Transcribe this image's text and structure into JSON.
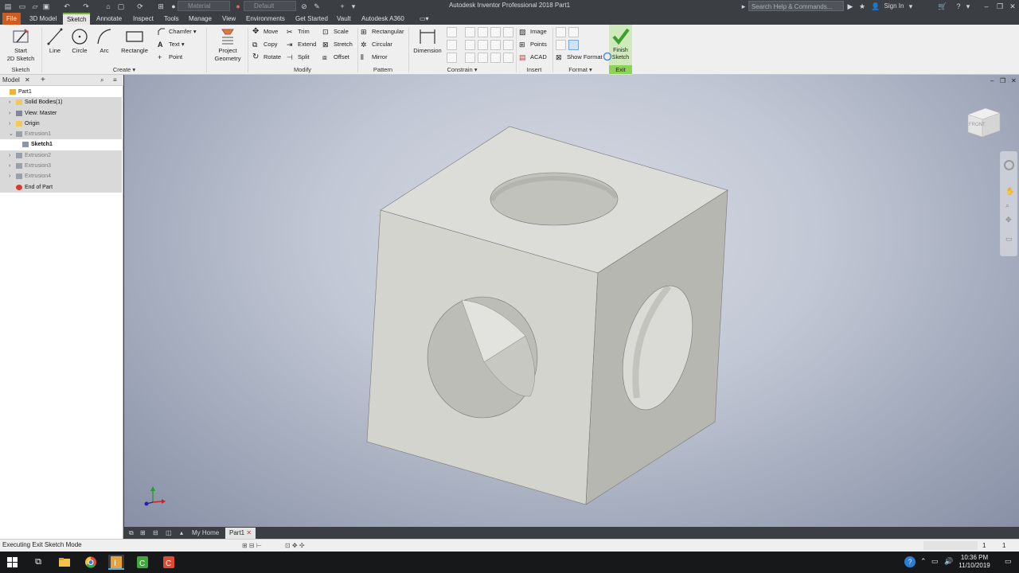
{
  "titlebar": {
    "title": "Autodesk Inventor Professional 2018   Part1",
    "material_field": "Material",
    "appearance_field": "Default",
    "search_placeholder": "Search Help & Commands...",
    "sign_in": "Sign In"
  },
  "tabs": [
    "File",
    "3D Model",
    "Sketch",
    "Annotate",
    "Inspect",
    "Tools",
    "Manage",
    "View",
    "Environments",
    "Get Started",
    "Vault",
    "Autodesk A360"
  ],
  "ribbon": {
    "sketch_panel": {
      "label": "Sketch",
      "start_2d_sketch": "Start\n2D Sketch"
    },
    "create_panel": {
      "label": "Create",
      "line": "Line",
      "circle": "Circle",
      "arc": "Arc",
      "rectangle": "Rectangle",
      "chamfer": "Chamfer",
      "text": "Text",
      "point": "Point",
      "project_geometry": "Project\nGeometry"
    },
    "modify_panel": {
      "label": "Modify",
      "move": "Move",
      "copy": "Copy",
      "rotate": "Rotate",
      "trim": "Trim",
      "extend": "Extend",
      "split": "Split",
      "scale": "Scale",
      "stretch": "Stretch",
      "offset": "Offset"
    },
    "pattern_panel": {
      "label": "Pattern",
      "rectangular": "Rectangular",
      "circular": "Circular",
      "mirror": "Mirror"
    },
    "constrain_panel": {
      "label": "Constrain",
      "dimension": "Dimension"
    },
    "insert_panel": {
      "label": "Insert",
      "image": "Image",
      "points": "Points",
      "acad": "ACAD"
    },
    "format_panel": {
      "label": "Format",
      "show_format": "Show Format"
    },
    "exit_panel": {
      "label": "Exit",
      "finish_sketch": "Finish\nSketch"
    }
  },
  "browser": {
    "tab_label": "Model",
    "tree": [
      {
        "label": "Part1",
        "icon": "part-icon",
        "level": 0,
        "exp": "",
        "style": "white"
      },
      {
        "label": "Solid Bodies(1)",
        "icon": "folder-icon",
        "level": 1,
        "exp": "+",
        "style": ""
      },
      {
        "label": "View: Master",
        "icon": "view-icon",
        "level": 1,
        "exp": "+",
        "style": ""
      },
      {
        "label": "Origin",
        "icon": "folder-icon",
        "level": 1,
        "exp": "+",
        "style": ""
      },
      {
        "label": "Extrusion1",
        "icon": "extrusion-icon",
        "level": 1,
        "exp": "-",
        "style": "dim"
      },
      {
        "label": "Sketch1",
        "icon": "sketch-icon",
        "level": 2,
        "exp": "",
        "style": "white bold"
      },
      {
        "label": "Extrusion2",
        "icon": "extrusion-icon",
        "level": 1,
        "exp": "+",
        "style": "dim"
      },
      {
        "label": "Extrusion3",
        "icon": "extrusion-icon",
        "level": 1,
        "exp": "+",
        "style": "dim"
      },
      {
        "label": "Extrusion4",
        "icon": "extrusion-icon",
        "level": 1,
        "exp": "+",
        "style": "dim"
      },
      {
        "label": "End of Part",
        "icon": "end-of-part-icon",
        "level": 1,
        "exp": "",
        "style": ""
      }
    ]
  },
  "viewcube": {
    "face_label": "FRONT"
  },
  "document_tabs": {
    "home": "My Home",
    "part": "Part1"
  },
  "status": {
    "message": "Executing Exit Sketch Mode",
    "count1": "1",
    "count2": "1"
  },
  "taskbar": {
    "time": "10:36 PM",
    "date": "11/10/2019"
  },
  "colors": {
    "file_tab": "#d05b1e",
    "active_tab_accent": "#78b934",
    "exit_panel": "#8fd258",
    "model_face": "#d6d6d2"
  }
}
